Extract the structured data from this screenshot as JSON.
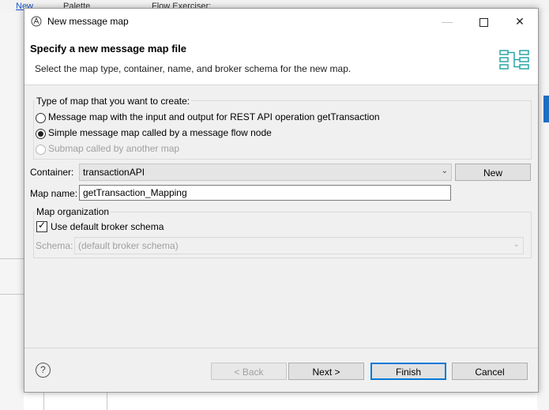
{
  "background": {
    "menu_label": "New",
    "palette_label": "Palette",
    "editor_tab_label": "Flow Exerciser:"
  },
  "dialog": {
    "title": "New message map",
    "header": {
      "title": "Specify a new message map file",
      "description": "Select the map type, container, name, and broker schema for the new map."
    },
    "map_type": {
      "legend": "Type of map that you want to create:",
      "options": [
        {
          "label": "Message map with the input and output for REST API operation getTransaction",
          "selected": false,
          "enabled": true
        },
        {
          "label": "Simple message map called by a message flow node",
          "selected": true,
          "enabled": true
        },
        {
          "label": "Submap called by another map",
          "selected": false,
          "enabled": false
        }
      ]
    },
    "container": {
      "label": "Container:",
      "value": "transactionAPI",
      "new_button": "New"
    },
    "map_name": {
      "label": "Map name:",
      "value": "getTransaction_Mapping"
    },
    "organization": {
      "legend": "Map organization",
      "use_default_label": "Use default broker schema",
      "use_default_checked": true,
      "schema_label": "Schema:",
      "schema_value": "(default broker schema)"
    },
    "buttons": {
      "back": "< Back",
      "next": "Next >",
      "finish": "Finish",
      "cancel": "Cancel"
    }
  },
  "colors": {
    "accent": "#0078d7",
    "disabled_text": "#a0a0a0"
  }
}
